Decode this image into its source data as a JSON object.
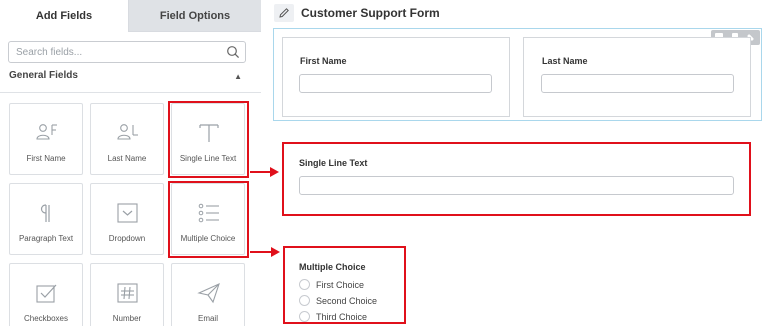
{
  "tabs": {
    "add_fields": "Add Fields",
    "field_options": "Field Options"
  },
  "search": {
    "placeholder": "Search fields..."
  },
  "section": {
    "title": "General Fields"
  },
  "fields": [
    {
      "label": "First Name",
      "icon": "person-first-icon"
    },
    {
      "label": "Last Name",
      "icon": "person-last-icon"
    },
    {
      "label": "Single Line Text",
      "icon": "text-t-icon"
    },
    {
      "label": "Paragraph Text",
      "icon": "paragraph-icon"
    },
    {
      "label": "Dropdown",
      "icon": "dropdown-icon"
    },
    {
      "label": "Multiple Choice",
      "icon": "list-icon"
    },
    {
      "label": "Checkboxes",
      "icon": "checkbox-icon"
    },
    {
      "label": "Number",
      "icon": "hash-icon"
    },
    {
      "label": "Email",
      "icon": "paper-plane-icon"
    }
  ],
  "form": {
    "title": "Customer Support Form",
    "first_name_label": "First Name",
    "last_name_label": "Last Name",
    "single_line_label": "Single Line Text",
    "multiple_choice_label": "Multiple Choice",
    "choices": [
      "First Choice",
      "Second Choice",
      "Third Choice"
    ]
  },
  "colors": {
    "highlight": "#e0101b",
    "row_selected_border": "#a9d7ec"
  }
}
